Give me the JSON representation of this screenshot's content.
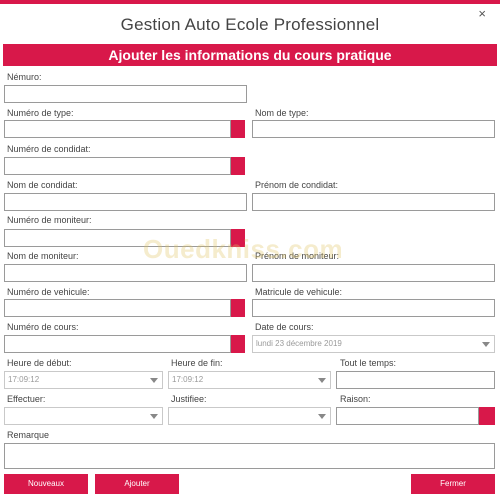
{
  "window": {
    "title": "Gestion Auto Ecole Professionnel",
    "close_glyph": "×"
  },
  "form": {
    "header": "Ajouter les informations du cours pratique",
    "labels": {
      "numero": "Némuro:",
      "numero_type": "Numéro de type:",
      "nom_type": "Nom de type:",
      "numero_condidat": "Numéro de condidat:",
      "nom_condidat": "Nom de condidat:",
      "prenom_condidat": "Prénom de condidat:",
      "numero_moniteur": "Numéro de moniteur:",
      "nom_moniteur": "Nom de moniteur:",
      "prenom_moniteur": "Prénom de moniteur:",
      "numero_vehicule": "Numéro de vehicule:",
      "matricule_vehicule": "Matricule de vehicule:",
      "numero_cours": "Numéro de cours:",
      "date_cours": "Date de cours:",
      "heure_debut": "Heure de début:",
      "heure_fin": "Heure de fin:",
      "tout_temps": "Tout le temps:",
      "effectuer": "Effectuer:",
      "justifiee": "Justifiee:",
      "raison": "Raison:",
      "remarque": "Remarque"
    },
    "values": {
      "date_cours": "lundi 23 décembre 2019",
      "heure_debut": "17:09:12",
      "heure_fin": "17:09:12"
    }
  },
  "buttons": {
    "nouveaux": "Nouveaux",
    "ajouter": "Ajouter",
    "fermer": "Fermer"
  },
  "watermark": "Ouedkniss.com",
  "colors": {
    "accent": "#d8184a"
  }
}
